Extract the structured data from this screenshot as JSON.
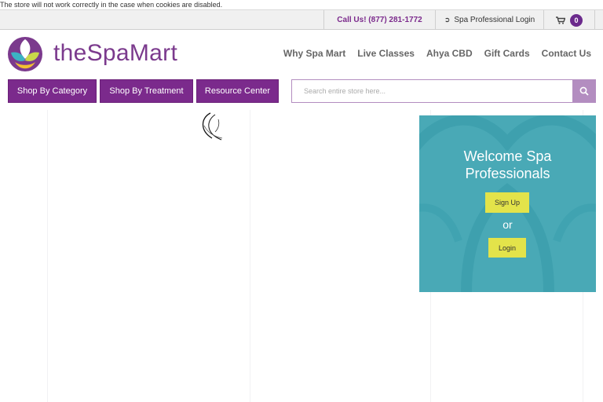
{
  "cookie_notice": "The store will not work correctly in the case when cookies are disabled.",
  "topbar": {
    "call_label": "Call Us! (877) 281-1772",
    "pro_login_label": "Spa Professional Login",
    "cart_count": "0"
  },
  "brand": {
    "name": "theSpaMart",
    "color": "#7b3a8d"
  },
  "main_nav": [
    "Why Spa Mart",
    "Live Classes",
    "Ahya CBD",
    "Gift Cards",
    "Contact Us"
  ],
  "category_buttons": [
    "Shop By Category",
    "Shop By Treatment",
    "Resource Center"
  ],
  "search": {
    "placeholder": "Search entire store here..."
  },
  "welcome_panel": {
    "title_line1": "Welcome Spa",
    "title_line2": "Professionals",
    "signup_label": "Sign Up",
    "or_label": "or",
    "login_label": "Login",
    "bg_color": "#49a9b6",
    "button_color": "#e3e34a"
  },
  "colors": {
    "accent_purple": "#7b2a8c"
  }
}
